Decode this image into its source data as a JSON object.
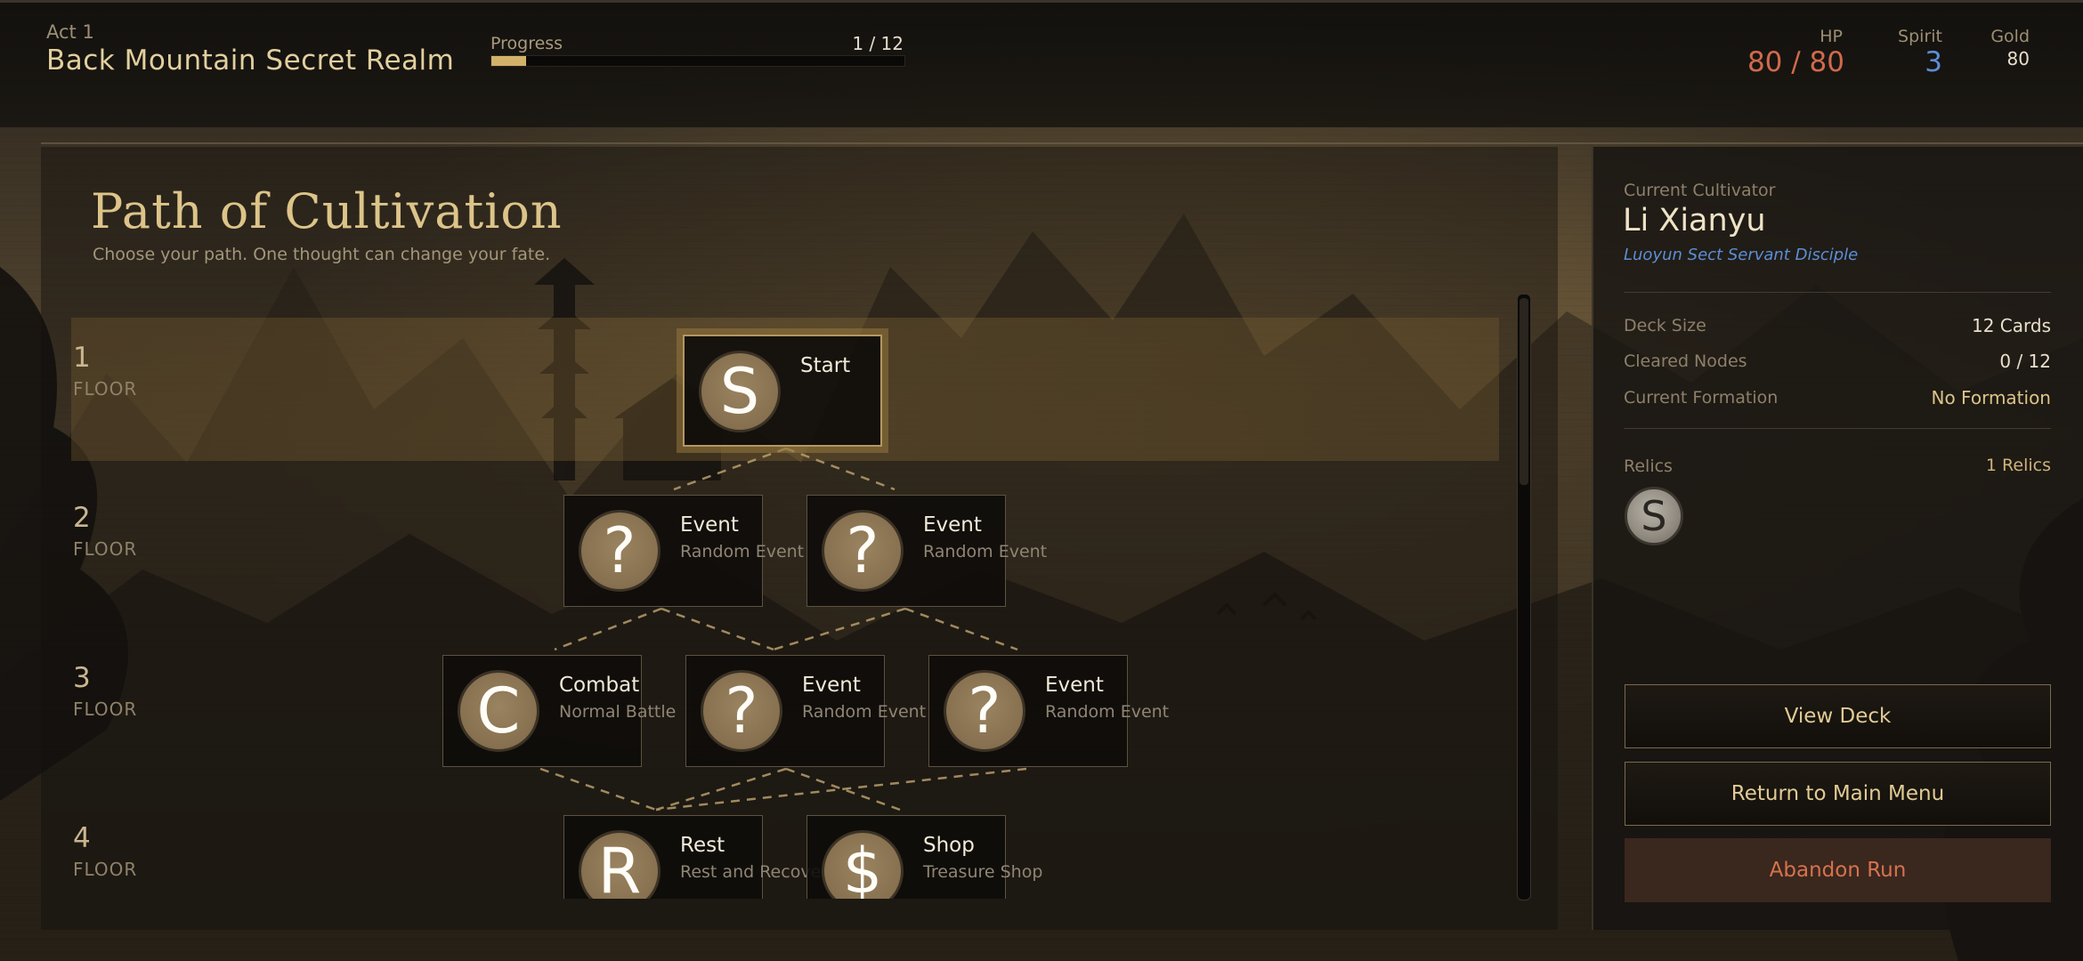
{
  "header": {
    "act": "Act 1",
    "realm": "Back Mountain Secret Realm",
    "progress_label": "Progress",
    "progress_text": "1 / 12",
    "progress_fraction": 0.0833,
    "hp_label": "HP",
    "hp_value": "80 / 80",
    "spirit_label": "Spirit",
    "spirit_value": "3",
    "gold_label": "Gold",
    "gold_value": "80"
  },
  "map": {
    "title": "Path of Cultivation",
    "subtitle": "Choose your path. One thought can change your fate.",
    "floor_word": "FLOOR",
    "floors": [
      "1",
      "2",
      "3",
      "4"
    ],
    "nodes": [
      {
        "id": "start",
        "floor": "1",
        "icon": "S",
        "icon_name": "start-icon",
        "title": "Start",
        "subtitle": ""
      },
      {
        "id": "f2a",
        "floor": "2",
        "icon": "?",
        "icon_name": "question-icon",
        "title": "Event",
        "subtitle": "Random Event"
      },
      {
        "id": "f2b",
        "floor": "2",
        "icon": "?",
        "icon_name": "question-icon",
        "title": "Event",
        "subtitle": "Random Event"
      },
      {
        "id": "f3a",
        "floor": "3",
        "icon": "C",
        "icon_name": "combat-icon",
        "title": "Combat",
        "subtitle": "Normal Battle"
      },
      {
        "id": "f3b",
        "floor": "3",
        "icon": "?",
        "icon_name": "question-icon",
        "title": "Event",
        "subtitle": "Random Event"
      },
      {
        "id": "f3c",
        "floor": "3",
        "icon": "?",
        "icon_name": "question-icon",
        "title": "Event",
        "subtitle": "Random Event"
      },
      {
        "id": "f4a",
        "floor": "4",
        "icon": "R",
        "icon_name": "rest-icon",
        "title": "Rest",
        "subtitle": "Rest and Recover"
      },
      {
        "id": "f4b",
        "floor": "4",
        "icon": "$",
        "icon_name": "shop-icon",
        "title": "Shop",
        "subtitle": "Treasure Shop"
      }
    ]
  },
  "cultivator": {
    "label": "Current Cultivator",
    "name": "Li Xianyu",
    "sect": "Luoyun Sect Servant Disciple",
    "deck_size_label": "Deck Size",
    "deck_size_value": "12 Cards",
    "cleared_label": "Cleared Nodes",
    "cleared_value": "0 / 12",
    "formation_label": "Current Formation",
    "formation_value": "No Formation",
    "relics_label": "Relics",
    "relics_count": "1 Relics",
    "relic_icon": "S"
  },
  "actions": {
    "view_deck": "View Deck",
    "main_menu": "Return to Main Menu",
    "abandon": "Abandon Run"
  },
  "colors": {
    "gold_accent": "#d2b26a",
    "hp": "#d06a4c",
    "spirit": "#5b8ed6",
    "danger": "#d6724e"
  }
}
